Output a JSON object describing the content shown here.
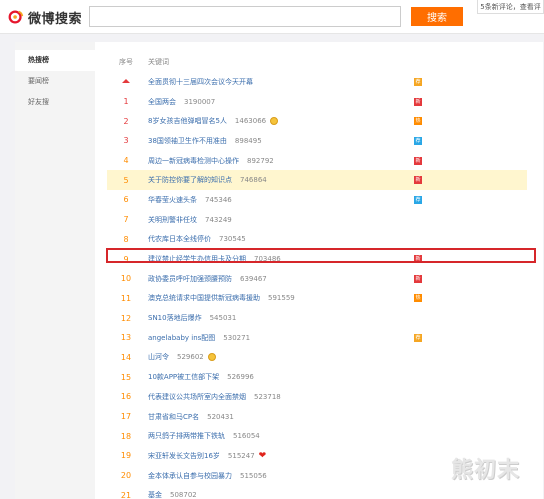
{
  "header": {
    "logo_text": "微博搜索",
    "search_placeholder": "",
    "search_button": "搜索",
    "notice": "5条新评论，查看评"
  },
  "sidebar": {
    "items": [
      {
        "label": "热搜榜",
        "active": true
      },
      {
        "label": "要闻榜",
        "active": false
      },
      {
        "label": "好友搜",
        "active": false
      }
    ]
  },
  "table": {
    "col_rank": "序号",
    "col_keyword": "关键词",
    "rows": [
      {
        "rank": "",
        "pinned": true,
        "keyword": "全面贯彻十三届四次会议今天开幕",
        "count": "",
        "badge": "jian",
        "badge_text": "荐"
      },
      {
        "rank": "1",
        "keyword": "全国两会",
        "count": "3190007",
        "badge": "new",
        "badge_text": "新"
      },
      {
        "rank": "2",
        "keyword": "8岁女孩吉他弹唱冒名5人",
        "count": "1463066",
        "emoji": "face",
        "badge": "hot",
        "badge_text": "热"
      },
      {
        "rank": "3",
        "keyword": "38国领袖卫生作不用准由",
        "count": "898495",
        "badge": "rec",
        "badge_text": "荐"
      },
      {
        "rank": "4",
        "keyword": "周边一新冠病毒检测中心操作",
        "count": "892792",
        "badge": "new",
        "badge_text": "新"
      },
      {
        "rank": "5",
        "keyword": "关于防控你要了解的知识点",
        "count": "746864",
        "highlight": true,
        "badge": "new",
        "badge_text": "新"
      },
      {
        "rank": "6",
        "keyword": "华春莹火速头条",
        "count": "745346",
        "badge": "rec",
        "badge_text": "荐"
      },
      {
        "rank": "7",
        "keyword": "关明刑警非任坟",
        "count": "743249"
      },
      {
        "rank": "8",
        "keyword": "代农库日本全线停价",
        "count": "730545"
      },
      {
        "rank": "9",
        "keyword": "建议禁止经学生办信用卡及分期",
        "count": "703486",
        "badge": "new",
        "badge_text": "新"
      },
      {
        "rank": "10",
        "keyword": "政协委员呼吁加强颈腰预防",
        "count": "639467",
        "badge": "new",
        "badge_text": "新"
      },
      {
        "rank": "11",
        "keyword": "澳克总统请求中国提供新冠病毒援助",
        "count": "591559",
        "badge": "hot",
        "badge_text": "热"
      },
      {
        "rank": "12",
        "keyword": "SN10落地后爆炸",
        "count": "545031"
      },
      {
        "rank": "13",
        "keyword": "angelababy ins配图",
        "count": "530271",
        "badge": "jian",
        "badge_text": "荐"
      },
      {
        "rank": "14",
        "keyword": "山河令",
        "count": "529602",
        "emoji": "face"
      },
      {
        "rank": "15",
        "keyword": "10款APP被工信部下架",
        "count": "526996"
      },
      {
        "rank": "16",
        "keyword": "代表建议公共场所室内全面禁烟",
        "count": "523718"
      },
      {
        "rank": "17",
        "keyword": "甘肃省和马CP名",
        "count": "520431"
      },
      {
        "rank": "18",
        "keyword": "两只鸽子排两带推下铁轨",
        "count": "516054"
      },
      {
        "rank": "19",
        "keyword": "宋亚轩发长文告别16岁",
        "count": "515247",
        "emoji": "heart"
      },
      {
        "rank": "20",
        "keyword": "金本体承认自参与校园暴力",
        "count": "515056"
      },
      {
        "rank": "21",
        "keyword": "基金",
        "count": "508702"
      }
    ]
  },
  "watermark": "熊初末",
  "colors": {
    "accent": "#ff6e00",
    "rank_top": "#e4393c",
    "rank": "#ff8c00",
    "link": "#3a6dac",
    "highlight_frame": "#d6262a"
  }
}
